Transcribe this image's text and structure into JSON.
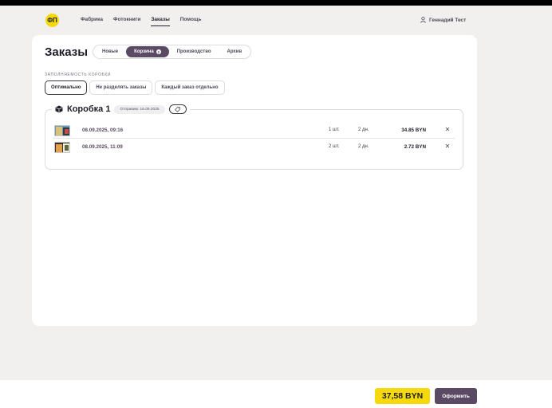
{
  "header": {
    "logo_text": "ФП",
    "nav": [
      {
        "label": "Фабрика"
      },
      {
        "label": "Фотокниги"
      },
      {
        "label": "Заказы",
        "active": true
      },
      {
        "label": "Помощь"
      }
    ],
    "user_name": "Геннадий Тест",
    "user_icon": "user-icon"
  },
  "page": {
    "title": "Заказы",
    "tabs": [
      {
        "label": "Новые"
      },
      {
        "label": "Корзина",
        "badge": "2",
        "active": true
      },
      {
        "label": "Производство"
      },
      {
        "label": "Архив"
      }
    ]
  },
  "box_fill": {
    "label": "ЗАПОЛНЯЕМОСТЬ КОРОБКИ",
    "options": [
      {
        "label": "Оптимально",
        "selected": true
      },
      {
        "label": "Не разделять заказы"
      },
      {
        "label": "Каждый заказ отдельно"
      }
    ]
  },
  "box": {
    "title": "Коробка 1",
    "ship_date": "Отправим: 16.09.2025",
    "icon": "box-icon",
    "tag_icon": "tag-icon",
    "orders": [
      {
        "date": "08.09.2025, 09:16",
        "qty": "1 шт.",
        "days": "2 дн.",
        "price": "34.85 BYN"
      },
      {
        "date": "08.09.2025, 11:09",
        "qty": "2 шт.",
        "days": "2 дн.",
        "price": "2.72 BYN"
      }
    ]
  },
  "footer": {
    "total": "37,58 BYN",
    "checkout_label": "Оформить"
  },
  "colors": {
    "accent_yellow": "#f5d90a",
    "accent_purple": "#5a4a63",
    "background": "#f1f0ee"
  }
}
